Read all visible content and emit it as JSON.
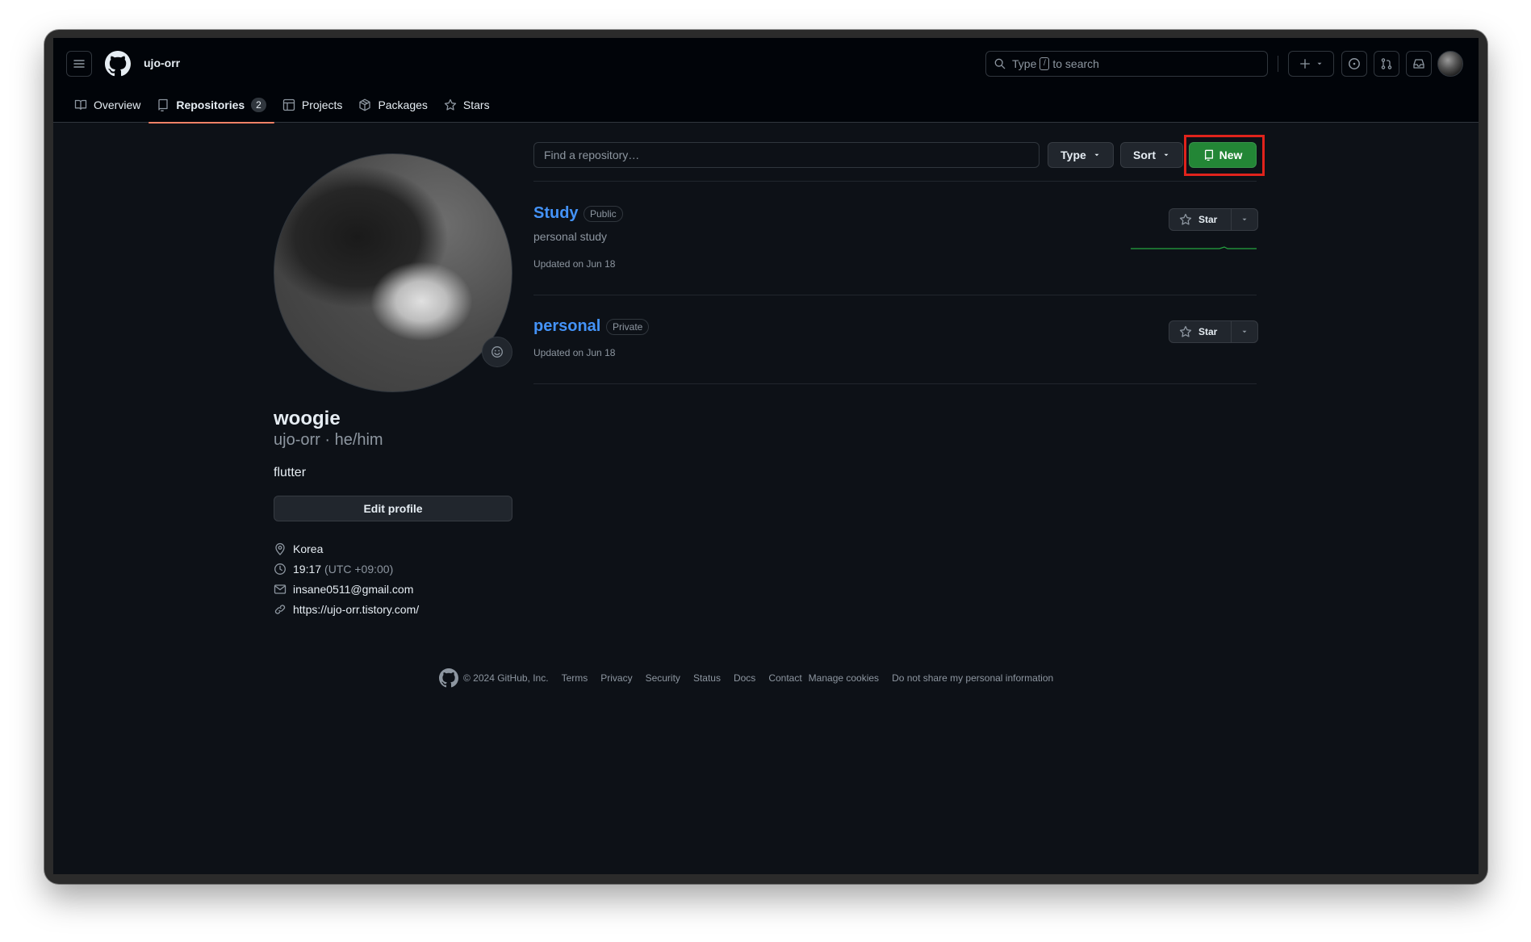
{
  "header": {
    "username": "ujo-orr",
    "search": {
      "prefix": "Type",
      "key": "/",
      "suffix": "to search"
    }
  },
  "nav": {
    "tabs": [
      {
        "label": "Overview",
        "icon": "book-icon"
      },
      {
        "label": "Repositories",
        "icon": "repo-icon",
        "count": "2",
        "active": true
      },
      {
        "label": "Projects",
        "icon": "table-icon"
      },
      {
        "label": "Packages",
        "icon": "package-icon"
      },
      {
        "label": "Stars",
        "icon": "star-icon"
      }
    ]
  },
  "profile": {
    "display_name": "woogie",
    "login_line": "ujo-orr · he/him",
    "bio": "flutter",
    "edit_label": "Edit profile",
    "location": "Korea",
    "time": "19:17",
    "timezone": "(UTC +09:00)",
    "email": "insane0511@gmail.com",
    "website": "https://ujo-orr.tistory.com/"
  },
  "repo_controls": {
    "search_placeholder": "Find a repository…",
    "type_label": "Type",
    "sort_label": "Sort",
    "new_label": "New"
  },
  "repos": [
    {
      "name": "Study",
      "visibility": "Public",
      "description": "personal study",
      "updated": "Updated on Jun 18",
      "star_label": "Star"
    },
    {
      "name": "personal",
      "visibility": "Private",
      "description": "",
      "updated": "Updated on Jun 18",
      "star_label": "Star"
    }
  ],
  "footer": {
    "copyright": "© 2024 GitHub, Inc.",
    "links": [
      "Terms",
      "Privacy",
      "Security",
      "Status",
      "Docs",
      "Contact",
      "Manage cookies",
      "Do not share my personal information"
    ]
  },
  "colors": {
    "background": "#0d1117",
    "header": "#010409",
    "link": "#4493f8",
    "accent_green": "#238636",
    "tab_underline": "#f78166",
    "highlight": "#e0231c"
  }
}
